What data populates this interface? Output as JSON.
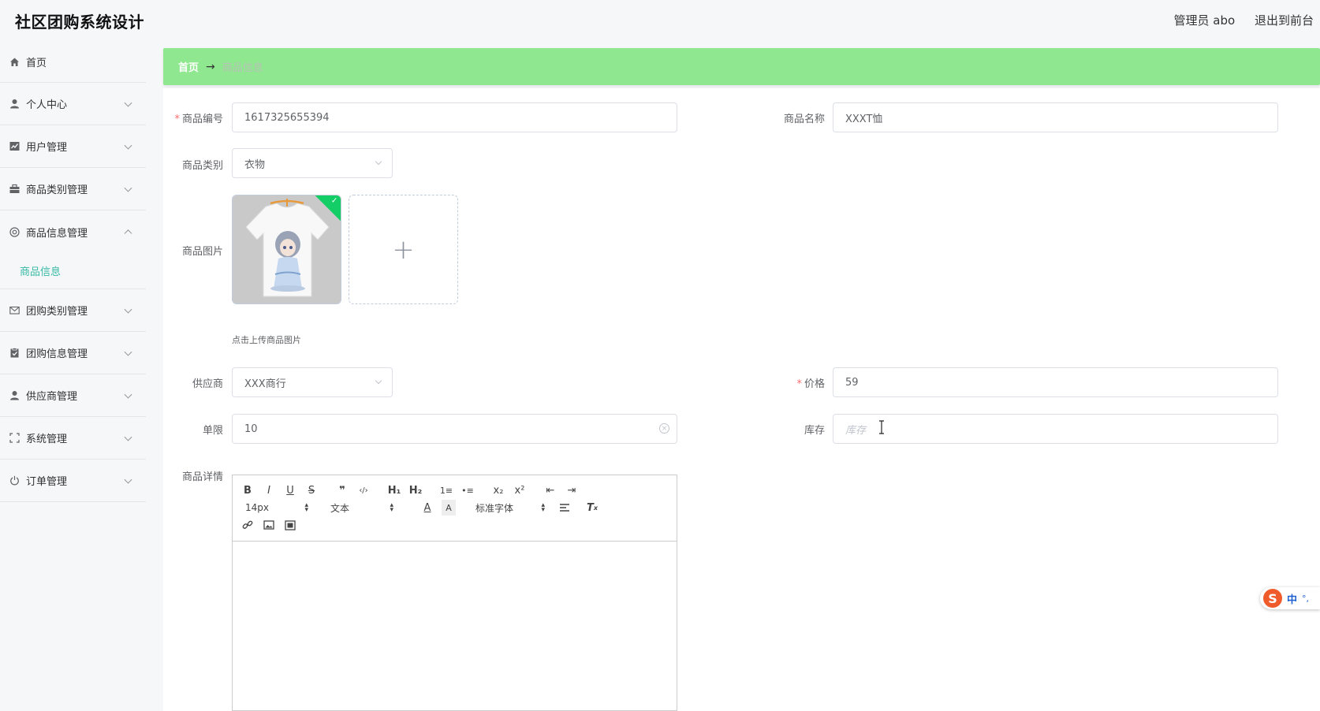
{
  "header": {
    "app_title": "社区团购系统设计",
    "user_label": "管理员 abo",
    "exit_label": "退出到前台"
  },
  "sidebar": {
    "items": [
      {
        "label": "首页",
        "icon": "home-icon"
      },
      {
        "label": "个人中心",
        "icon": "user-icon"
      },
      {
        "label": "用户管理",
        "icon": "chart-icon"
      },
      {
        "label": "商品类别管理",
        "icon": "briefcase-icon"
      },
      {
        "label": "商品信息管理",
        "icon": "lifebuoy-icon",
        "expanded": true
      },
      {
        "label": "团购类别管理",
        "icon": "mail-icon"
      },
      {
        "label": "团购信息管理",
        "icon": "clipboard-icon"
      },
      {
        "label": "供应商管理",
        "icon": "user-icon"
      },
      {
        "label": "系统管理",
        "icon": "fullscreen-icon"
      },
      {
        "label": "订单管理",
        "icon": "power-icon"
      }
    ],
    "submenu_active": "商品信息"
  },
  "breadcrumb": {
    "home": "首页",
    "separator": "→",
    "current": "商品信息"
  },
  "form": {
    "code_label": "商品编号",
    "code_value": "1617325655394",
    "name_label": "商品名称",
    "name_value": "XXXT恤",
    "category_label": "商品类别",
    "category_value": "衣物",
    "image_label": "商品图片",
    "upload_tip": "点击上传商品图片",
    "upload_plus": "+",
    "supplier_label": "供应商",
    "supplier_value": "XXX商行",
    "price_label": "价格",
    "price_value": "59",
    "limit_label": "单限",
    "limit_value": "10",
    "stock_label": "库存",
    "stock_placeholder": "库存",
    "detail_label": "商品详情"
  },
  "editor": {
    "row1": [
      "B",
      "I",
      "U",
      "S",
      "❞",
      "‹/›",
      "H₁",
      "H₂",
      "1≡",
      "•≡",
      "x₂",
      "x²",
      "⇤",
      "⇥"
    ],
    "font_size": "14px",
    "block_type": "文本",
    "font_family": "标准字体",
    "row3_icons": [
      "link-icon",
      "image-icon",
      "video-icon"
    ]
  },
  "ime": {
    "logo": "S",
    "mode": "中",
    "punct": "°,"
  },
  "colors": {
    "breadcrumb_bg": "#8fe88f",
    "accent": "#36b9a4",
    "required": "#f56c6c",
    "upload_success": "#13ce66"
  }
}
